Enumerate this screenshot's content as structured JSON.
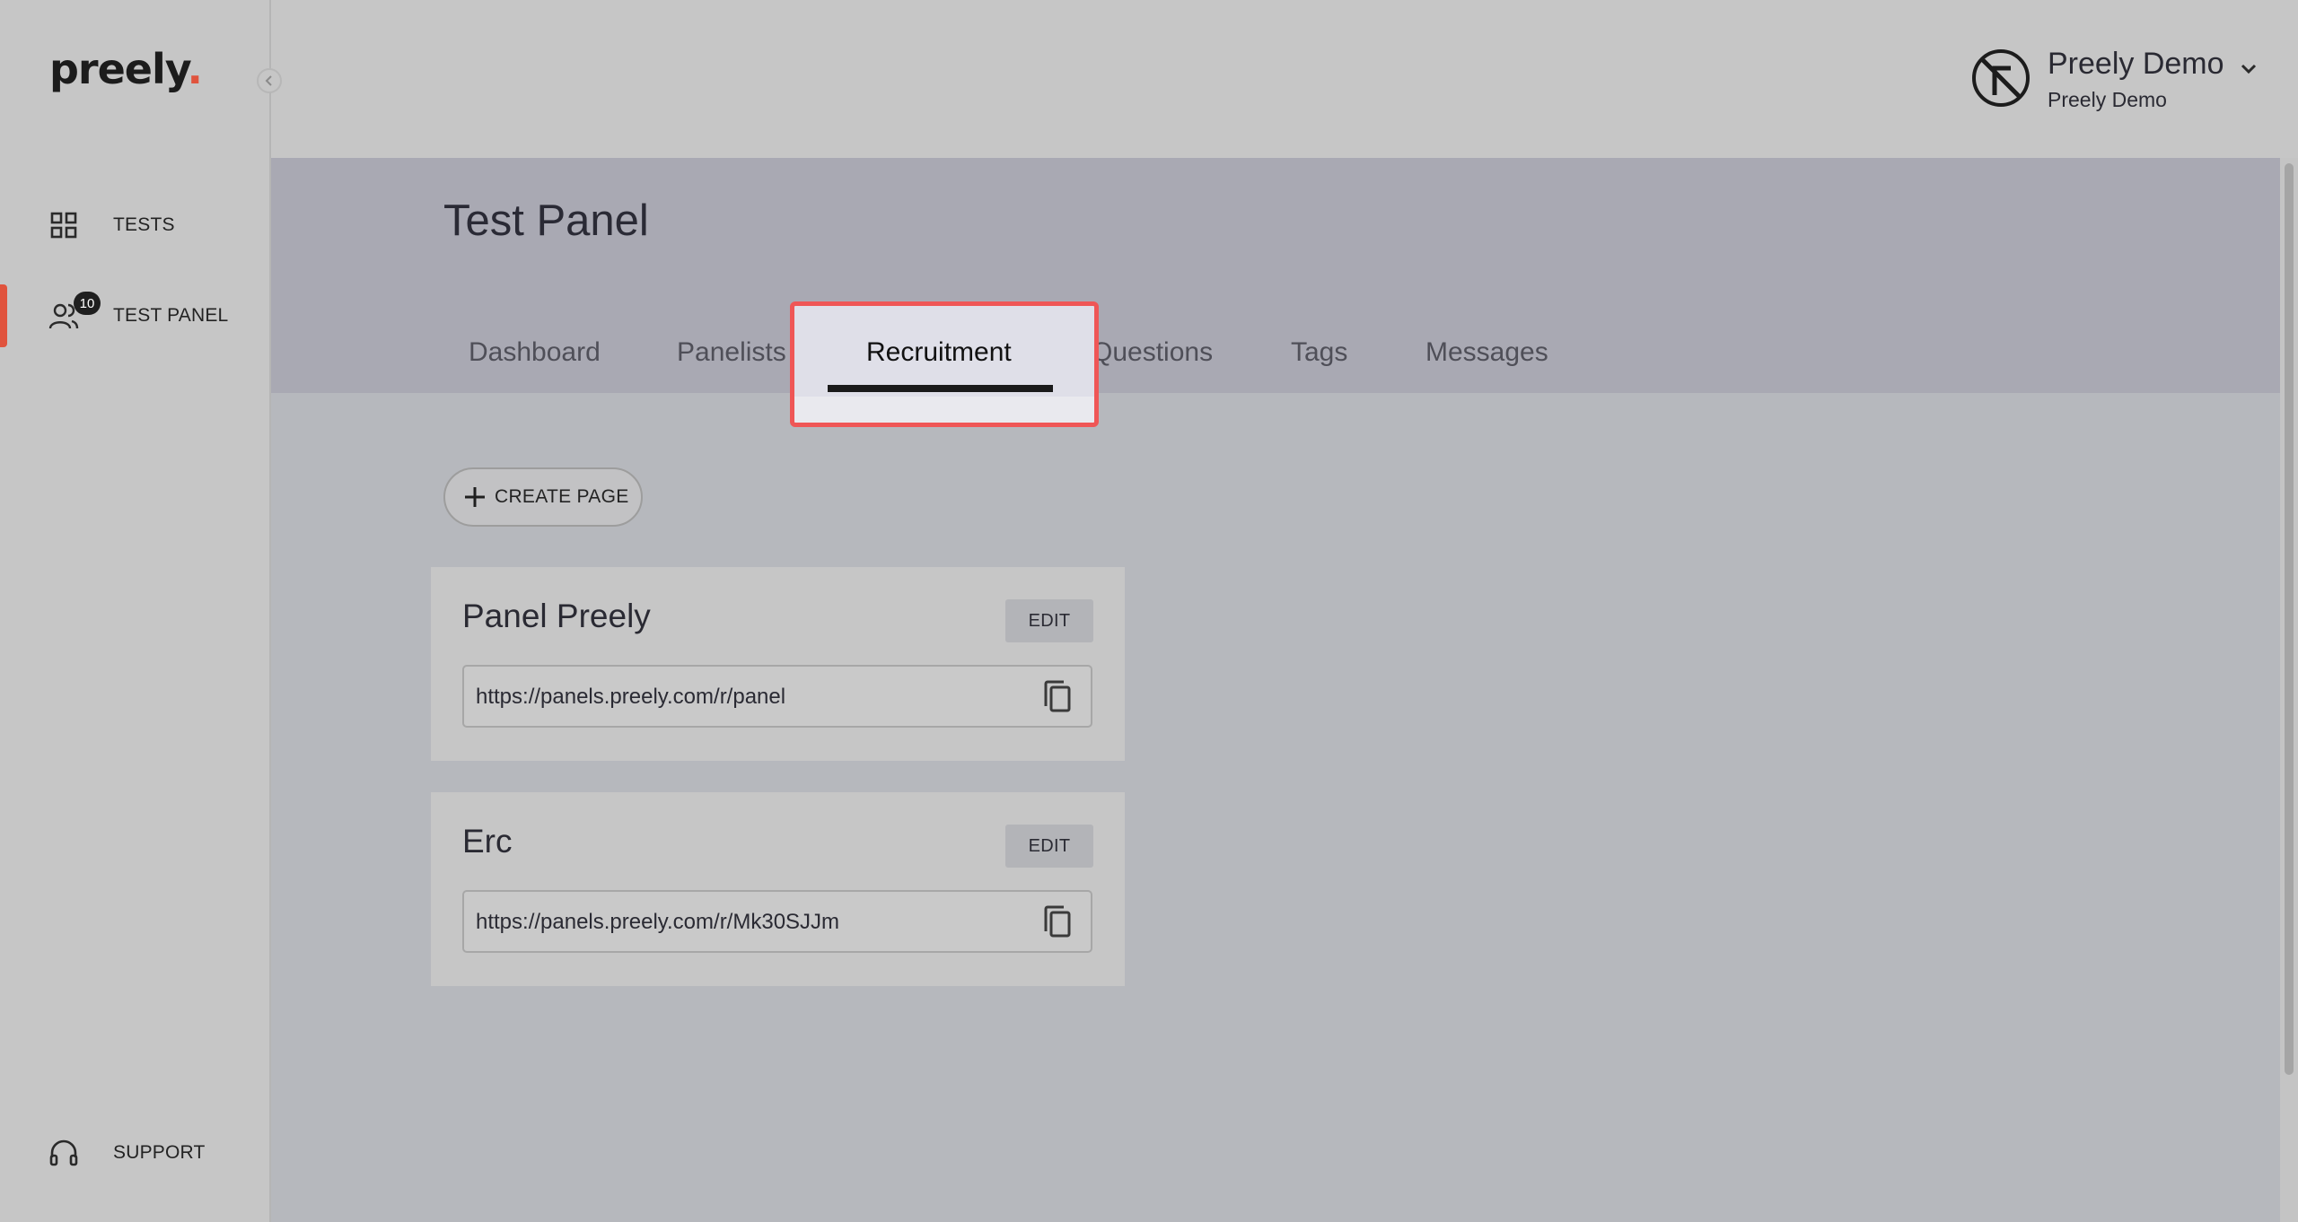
{
  "sidebar": {
    "logo_text": "preely",
    "logo_dot": ".",
    "collapse_icon": "chevron-left-icon",
    "items": [
      {
        "label": "TESTS",
        "icon": "grid-icon"
      },
      {
        "label": "TEST PANEL",
        "icon": "users-icon",
        "badge": "10",
        "active": true
      }
    ],
    "support_label": "SUPPORT",
    "support_icon": "headset-icon"
  },
  "header": {
    "user_name": "Preely Demo",
    "user_org": "Preely Demo",
    "avatar_icon": "brand-avatar-icon",
    "menu_icon": "chevron-down-icon"
  },
  "main": {
    "title": "Test Panel",
    "tabs": [
      {
        "label": "Dashboard"
      },
      {
        "label": "Panelists"
      },
      {
        "label": "Recruitment",
        "active": true
      },
      {
        "label": "Questions"
      },
      {
        "label": "Tags"
      },
      {
        "label": "Messages"
      }
    ],
    "create_button_label": "CREATE PAGE",
    "pages": [
      {
        "title": "Panel Preely",
        "edit_label": "EDIT",
        "url": "https://panels.preely.com/r/panel"
      },
      {
        "title": "Erc",
        "edit_label": "EDIT",
        "url": "https://panels.preely.com/r/Mk30SJJm"
      }
    ]
  },
  "colors": {
    "accent": "#e0533d",
    "highlight_border": "#ef5656",
    "header_band": "#a9a9b3",
    "sidebar_bg": "#c6c6c6"
  }
}
